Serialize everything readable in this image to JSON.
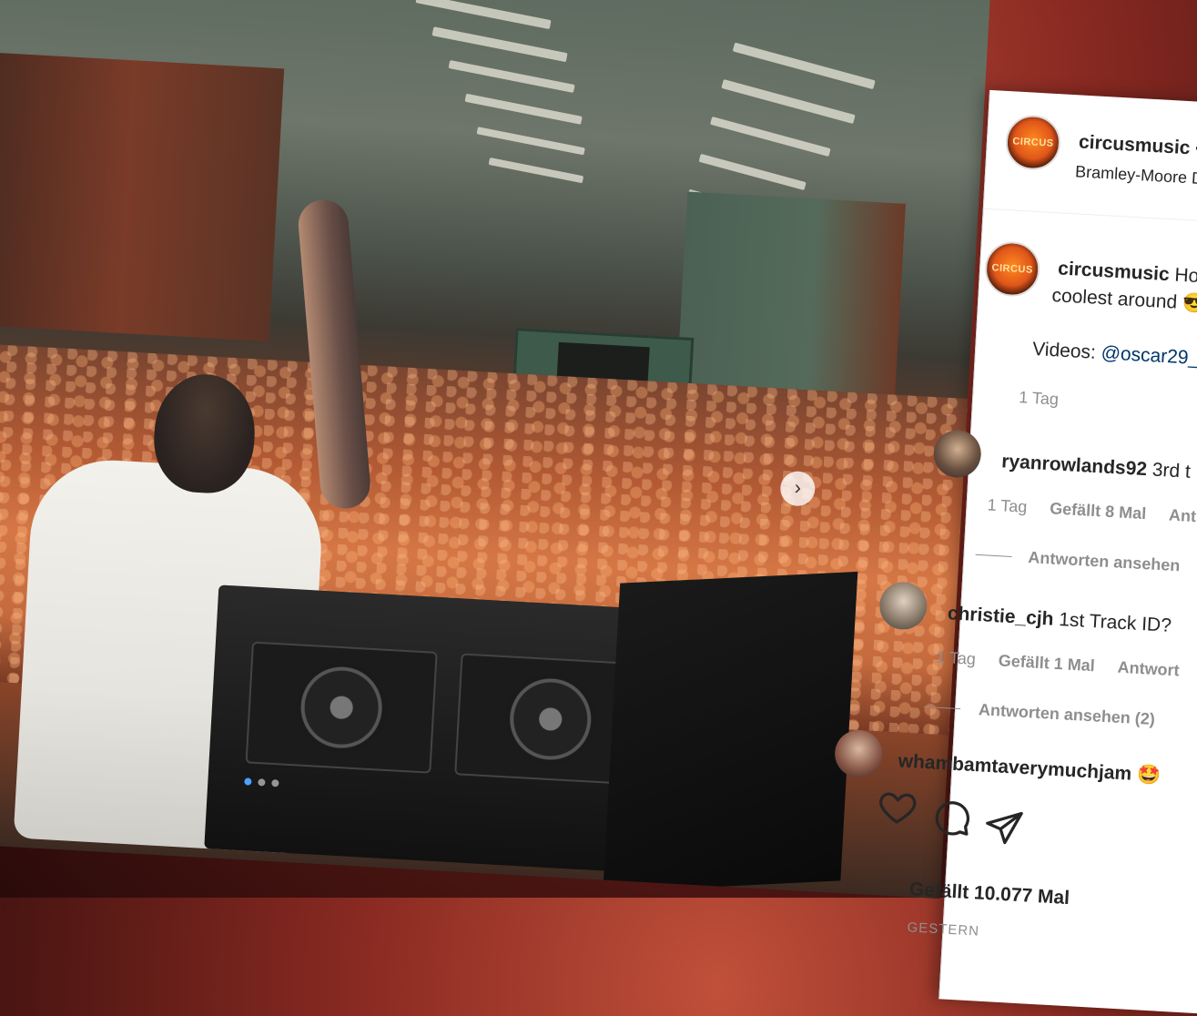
{
  "post": {
    "username": "circusmusic",
    "separator": "•",
    "location": "Bramley-Moore D",
    "avatar_text": "CIRCUS",
    "caption_text": "Hot",
    "caption_line2": "coolest around",
    "caption_emoji": "😎",
    "videos_label": "Videos:",
    "videos_link": "@oscar29_",
    "caption_age": "1 Tag"
  },
  "comments": [
    {
      "username": "ryanrowlands92",
      "text": "3rd t",
      "age": "1 Tag",
      "likes": "Gefällt 8 Mal",
      "reply": "Ant",
      "view_replies": "Antworten ansehen"
    },
    {
      "username": "christie_cjh",
      "text": "1st Track ID?",
      "age": "1 Tag",
      "likes": "Gefällt 1 Mal",
      "reply": "Antwort",
      "view_replies": "Antworten ansehen (2)"
    },
    {
      "username": "whambamtaverymuchjam",
      "text": "🤩"
    }
  ],
  "actions": {
    "like_icon": "heart-icon",
    "comment_icon": "comment-icon",
    "share_icon": "share-icon",
    "likes_count": "Gefällt 10.077 Mal",
    "date": "GESTERN"
  },
  "carousel": {
    "next_icon": "›",
    "dots": 3,
    "active_dot": 0
  }
}
